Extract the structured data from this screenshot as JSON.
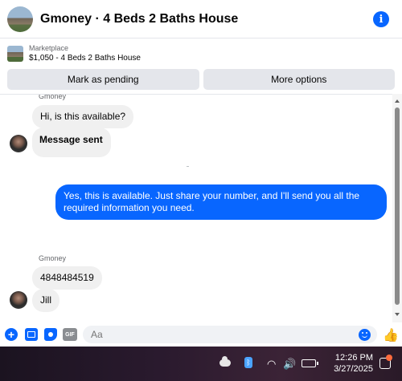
{
  "header": {
    "title": "Gmoney · 4 Beds 2 Baths House",
    "info_icon": "info-icon"
  },
  "marketplace": {
    "label": "Marketplace",
    "item": "$1,050 - 4 Beds 2 Baths House"
  },
  "actions": {
    "mark_pending": "Mark as pending",
    "more_options": "More options"
  },
  "messages": {
    "sender_top": "Gmoney",
    "m1": "Hi, is this available?",
    "m2": "Message sent",
    "reply": "Yes, this is available. Just share your number, and I'll send you all the required information you need.",
    "sender_bottom": "Gmoney",
    "m3": "4848484519",
    "m4": "Jill"
  },
  "composer": {
    "placeholder": "Aa"
  },
  "taskbar": {
    "time": "12:26 PM",
    "date": "3/27/2025"
  },
  "colors": {
    "accent": "#0866ff",
    "incoming_bubble": "#f0f0f0"
  }
}
